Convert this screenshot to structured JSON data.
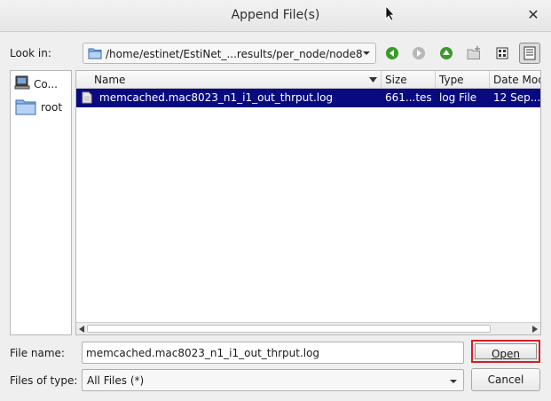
{
  "window": {
    "title": "Append File(s)"
  },
  "toolbar": {
    "look_in_label": "Look in:",
    "path": "/home/estinet/EstiNet_...results/per_node/node8"
  },
  "places": [
    {
      "label": "Co...",
      "icon": "computer-icon"
    },
    {
      "label": "root",
      "icon": "folder-icon"
    }
  ],
  "file_list": {
    "columns": [
      "Name",
      "Size",
      "Type",
      "Date Mod"
    ],
    "rows": [
      {
        "name": "memcached.mac8023_n1_i1_out_thrput.log",
        "size": "661...tes",
        "type": "log File",
        "date": "12 Sep..."
      }
    ]
  },
  "footer": {
    "file_name_label": "File name:",
    "file_name_value": "memcached.mac8023_n1_i1_out_thrput.log",
    "file_type_label": "Files of type:",
    "file_type_value": "All Files (*)",
    "open_label": "Open",
    "cancel_label": "Cancel"
  },
  "colors": {
    "selection": "#0a0a80",
    "highlight_border": "#d0202a",
    "nav_green": "#3a9a2a"
  }
}
